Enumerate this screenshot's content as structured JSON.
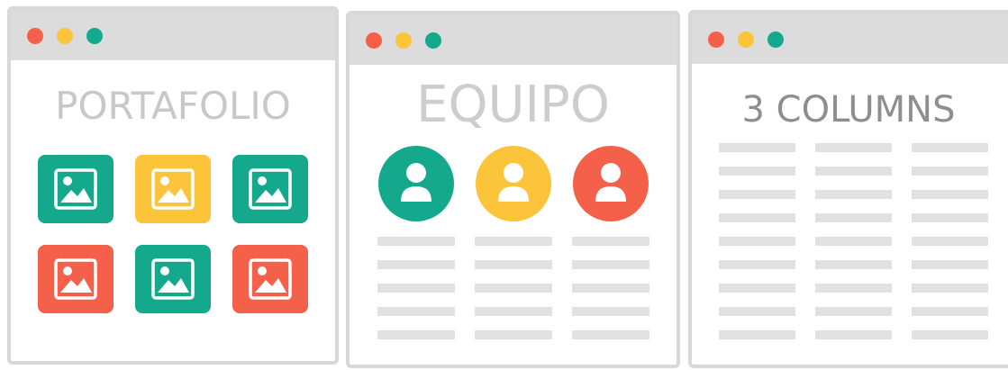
{
  "colors": {
    "red": "#f4604a",
    "yellow": "#fcc43a",
    "green": "#14a98c",
    "titlebar": "#dcdcdc",
    "bar": "#e1e1e1"
  },
  "windows": [
    {
      "title": "PORTAFOLIO",
      "controls": [
        "close-dot",
        "minimize-dot",
        "maximize-dot"
      ],
      "gallery": {
        "rows": [
          [
            "green",
            "yellow",
            "green"
          ],
          [
            "red",
            "green",
            "red"
          ]
        ],
        "icon": "image-icon"
      }
    },
    {
      "title": "EQUIPO",
      "controls": [
        "close-dot",
        "minimize-dot",
        "maximize-dot"
      ],
      "team": {
        "members": [
          "green",
          "yellow",
          "red"
        ],
        "icon": "user-icon",
        "text_columns": 3,
        "lines_per_column": 5
      }
    },
    {
      "title": "3 COLUMNS",
      "controls": [
        "close-dot",
        "minimize-dot",
        "maximize-dot"
      ],
      "columns": {
        "count": 3,
        "lines_per_column": 9
      }
    }
  ]
}
